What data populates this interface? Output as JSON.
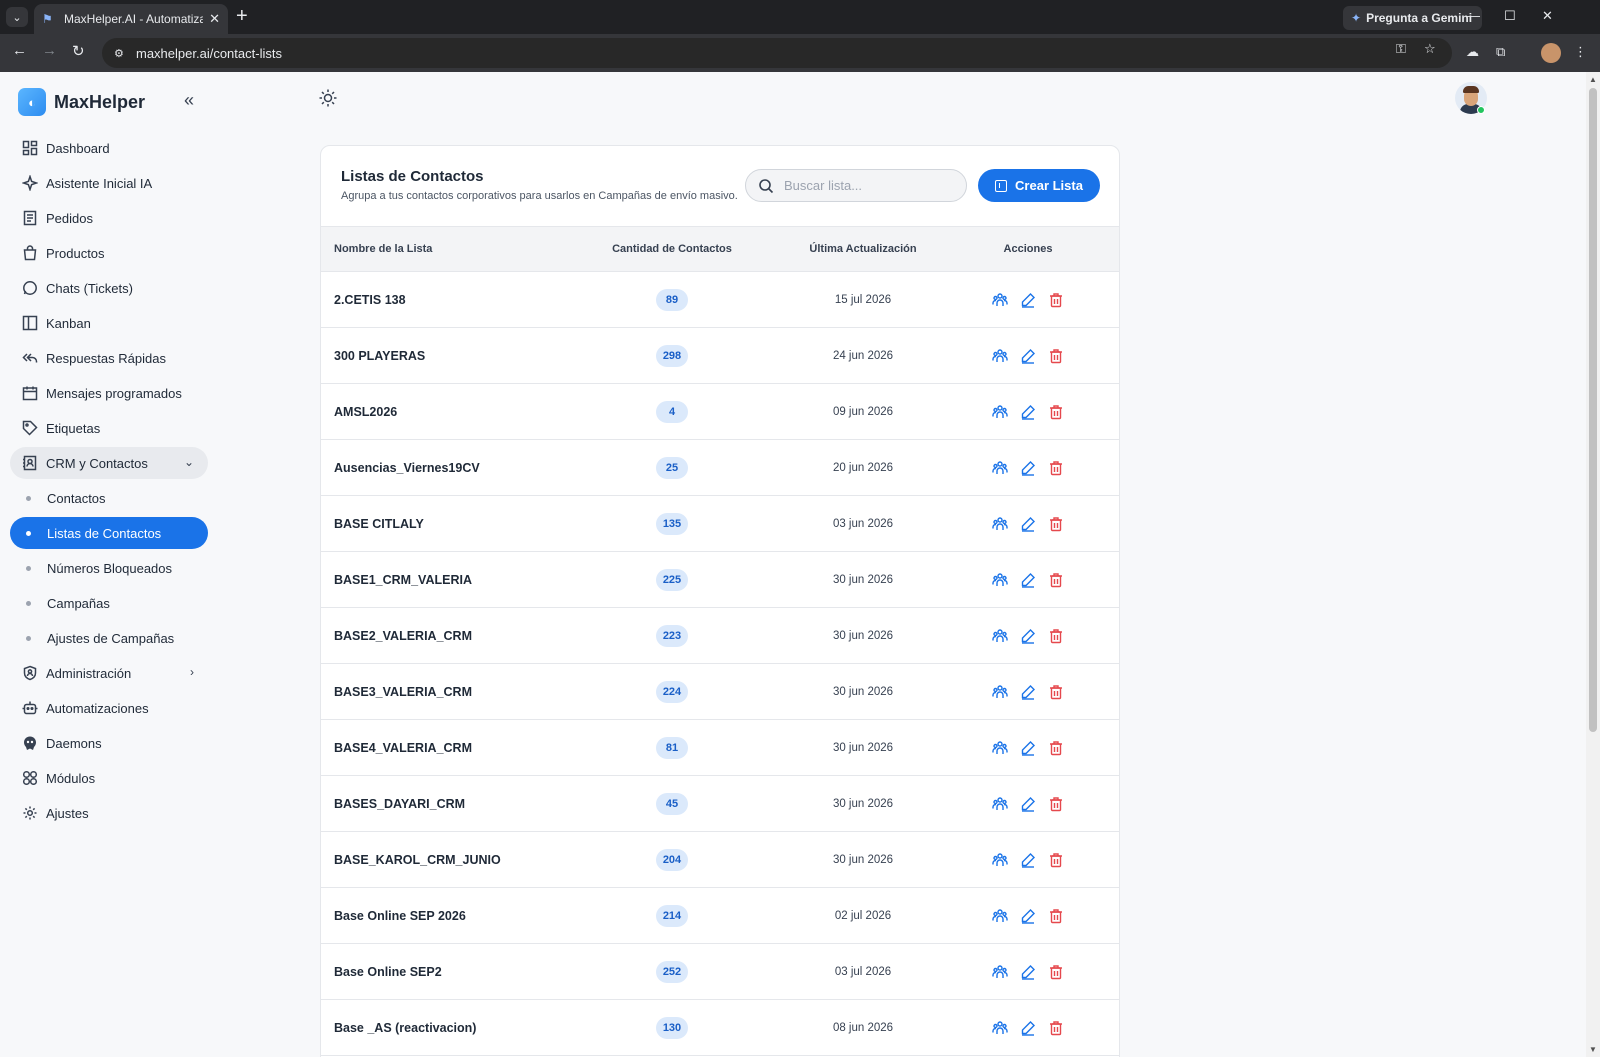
{
  "browser": {
    "tab_title": "MaxHelper.AI - Automatiza tu atención",
    "url": "maxhelper.ai/contact-lists",
    "gemini_label": "Pregunta a Gemini"
  },
  "sidebar": {
    "brand": "MaxHelper",
    "items": [
      {
        "label": "Dashboard"
      },
      {
        "label": "Asistente Inicial IA"
      },
      {
        "label": "Pedidos"
      },
      {
        "label": "Productos"
      },
      {
        "label": "Chats (Tickets)"
      },
      {
        "label": "Kanban"
      },
      {
        "label": "Respuestas Rápidas"
      },
      {
        "label": "Mensajes programados"
      },
      {
        "label": "Etiquetas"
      },
      {
        "label": "CRM y Contactos"
      },
      {
        "label": "Contactos"
      },
      {
        "label": "Listas de Contactos"
      },
      {
        "label": "Números Bloqueados"
      },
      {
        "label": "Campañas"
      },
      {
        "label": "Ajustes de Campañas"
      },
      {
        "label": "Administración"
      },
      {
        "label": "Automatizaciones"
      },
      {
        "label": "Daemons"
      },
      {
        "label": "Módulos"
      },
      {
        "label": "Ajustes"
      }
    ]
  },
  "card": {
    "title": "Listas de Contactos",
    "subtitle": "Agrupa a tus contactos corporativos para usarlos en Campañas de envío masivo.",
    "search_placeholder": "Buscar lista...",
    "create_label": "Crear Lista"
  },
  "table": {
    "headers": [
      "Nombre de la Lista",
      "Cantidad de Contactos",
      "Última Actualización",
      "Acciones"
    ],
    "rows": [
      {
        "name": "2.CETIS 138",
        "count": "89",
        "date": "15 jul 2026"
      },
      {
        "name": "300 PLAYERAS",
        "count": "298",
        "date": "24 jun 2026"
      },
      {
        "name": "AMSL2026",
        "count": "4",
        "date": "09 jun 2026"
      },
      {
        "name": "Ausencias_Viernes19CV",
        "count": "25",
        "date": "20 jun 2026"
      },
      {
        "name": "BASE CITLALY",
        "count": "135",
        "date": "03 jun 2026"
      },
      {
        "name": "BASE1_CRM_VALERIA",
        "count": "225",
        "date": "30 jun 2026"
      },
      {
        "name": "BASE2_VALERIA_CRM",
        "count": "223",
        "date": "30 jun 2026"
      },
      {
        "name": "BASE3_VALERIA_CRM",
        "count": "224",
        "date": "30 jun 2026"
      },
      {
        "name": "BASE4_VALERIA_CRM",
        "count": "81",
        "date": "30 jun 2026"
      },
      {
        "name": "BASES_DAYARI_CRM",
        "count": "45",
        "date": "30 jun 2026"
      },
      {
        "name": "BASE_KAROL_CRM_JUNIO",
        "count": "204",
        "date": "30 jun 2026"
      },
      {
        "name": "Base Online SEP 2026",
        "count": "214",
        "date": "02 jul 2026"
      },
      {
        "name": "Base Online SEP2",
        "count": "252",
        "date": "03 jul 2026"
      },
      {
        "name": "Base _AS (reactivacion)",
        "count": "130",
        "date": "08 jun 2026"
      }
    ]
  },
  "colors": {
    "accent": "#1a73e8",
    "delete": "#e5484d",
    "badge_bg": "#dbe9fb"
  }
}
